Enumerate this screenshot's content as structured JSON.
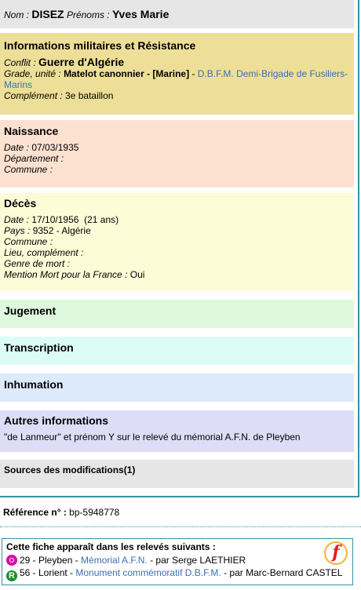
{
  "identity": {
    "nom_label": "Nom :",
    "nom": "DISEZ",
    "prenoms_label": "Prénoms :",
    "prenoms": "Yves Marie"
  },
  "militaire": {
    "title": "Informations militaires et Résistance",
    "conflit_label": "Conflit :",
    "conflit": "Guerre d'Algérie",
    "grade_label": "Grade, unité :",
    "grade": "Matelot canonnier - ",
    "arme": "[Marine]",
    "unite_sep": " - ",
    "unite_link": "D.B.F.M. Demi-Brigade de Fusiliers-Marins",
    "complement_label": "Complément :",
    "complement": "3e bataillon"
  },
  "naissance": {
    "title": "Naissance",
    "date_label": "Date :",
    "date": "07/03/1935",
    "departement_label": "Département :",
    "departement": "",
    "commune_label": "Commune :",
    "commune": ""
  },
  "deces": {
    "title": "Décès",
    "date_label": "Date :",
    "date": "17/10/1956  (21 ans)",
    "pays_label": "Pays :",
    "pays": "9352 - Algérie",
    "commune_label": "Commune :",
    "commune": "",
    "lieu_label": "Lieu, complément :",
    "lieu": "",
    "genre_label": "Genre de mort :",
    "genre": "",
    "mention_label": "Mention Mort pour la France :",
    "mention": "Oui"
  },
  "jugement": {
    "title": "Jugement"
  },
  "transcription": {
    "title": "Transcription"
  },
  "inhumation": {
    "title": "Inhumation"
  },
  "autres": {
    "title": "Autres informations",
    "text": "\"de Lanmeur\" et prénom Y sur le relevé du mémorial A.F.N. de Pleyben"
  },
  "sources": {
    "title": "Sources des modifications(1)"
  },
  "reference": {
    "label": "Référence n° :",
    "value": "bp-5948778"
  },
  "releves": {
    "title": "Cette fiche apparaît dans les relevés suivants :",
    "items": [
      {
        "icon": "memorial-icon",
        "prefix": "29 - Pleyben - ",
        "link": "Mémorial A.F.N.",
        "suffix": " - par Serge LAETHIER"
      },
      {
        "icon": "releve-r-icon",
        "icon_letter": "R",
        "prefix": "56 - Lorient - ",
        "link": "Monument commémoratif D.B.F.M.",
        "suffix": " - par Marc-Bernard CASTEL"
      }
    ],
    "badge": "f",
    "link_color": "#3b6fb6"
  }
}
